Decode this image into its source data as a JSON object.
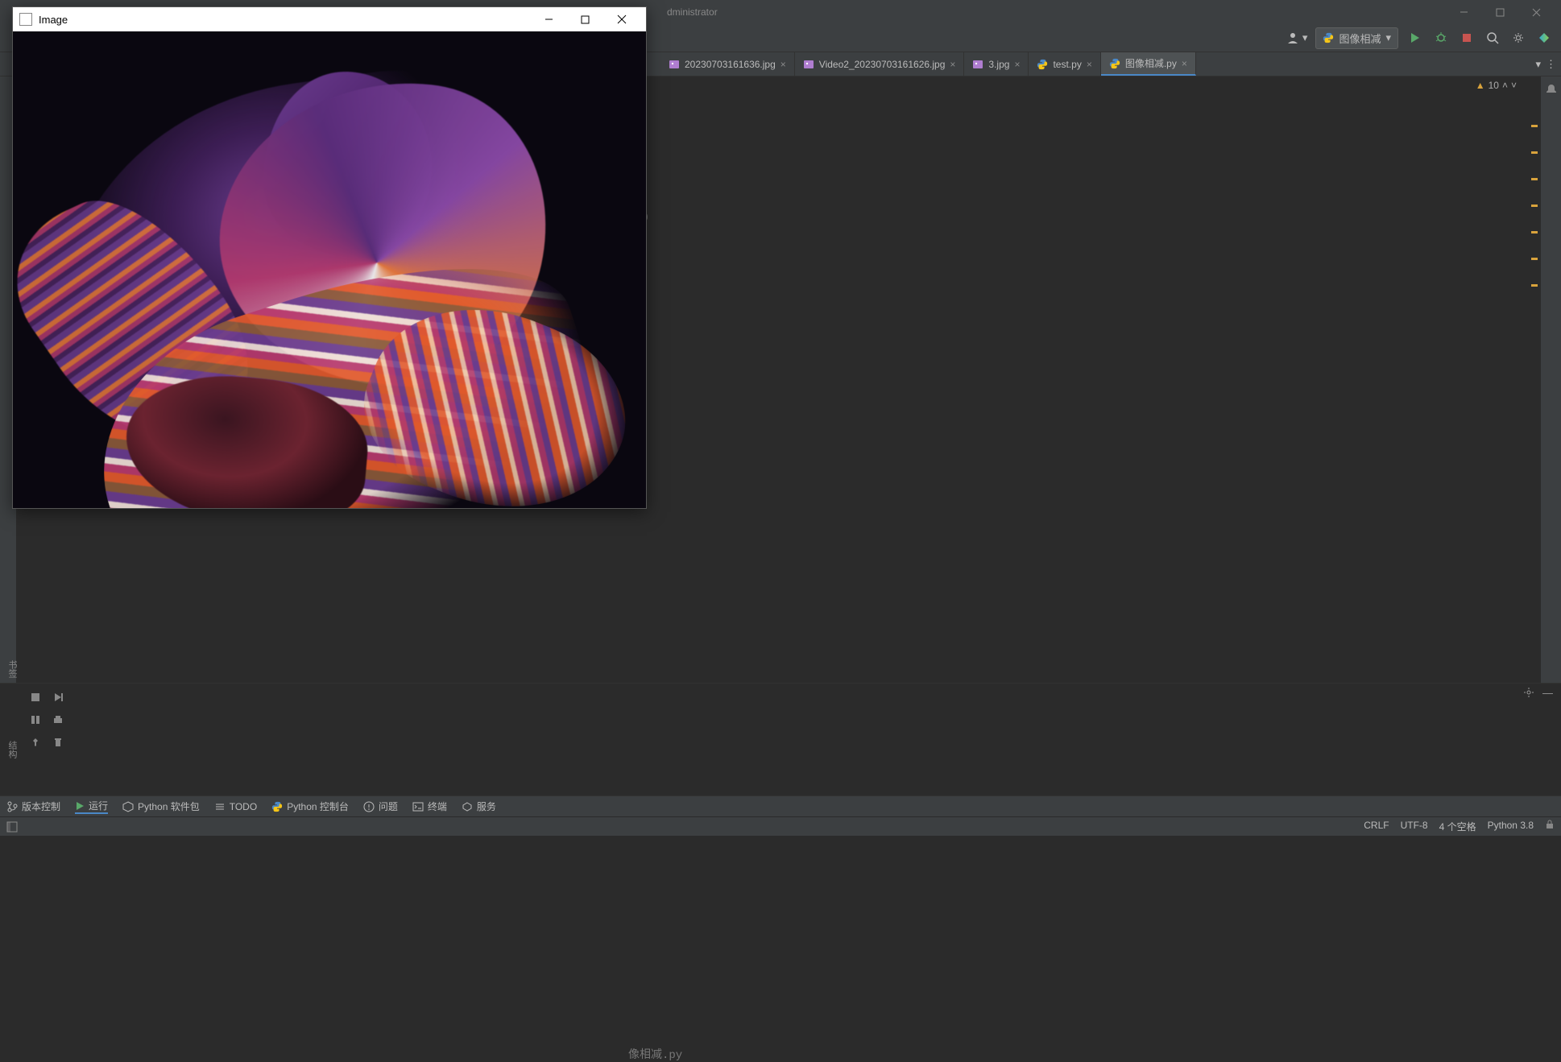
{
  "titlebar": {
    "title_fragment": "dministrator"
  },
  "toolbar": {
    "run_config_label": "图像相减"
  },
  "tabs": [
    {
      "label": "20230703161636.jpg",
      "type": "image",
      "active": false
    },
    {
      "label": "Video2_20230703161626.jpg",
      "type": "image",
      "active": false
    },
    {
      "label": "3.jpg",
      "type": "image",
      "active": false
    },
    {
      "label": "test.py",
      "type": "python",
      "active": false
    },
    {
      "label": "图像相减.py",
      "type": "python",
      "active": true
    }
  ],
  "editor": {
    "warning_count": "10",
    "code_fragment": ")",
    "run_path_fragment": "像相减.py"
  },
  "bottom_tools": {
    "version_control": "版本控制",
    "run": "运行",
    "python_packages": "Python 软件包",
    "todo": "TODO",
    "python_console": "Python 控制台",
    "problems": "问题",
    "terminal": "终端",
    "services": "服务"
  },
  "side_tabs": {
    "bookmarks": "书签",
    "structure": "结构"
  },
  "statusbar": {
    "line_ending": "CRLF",
    "encoding": "UTF-8",
    "indent": "4 个空格",
    "interpreter": "Python 3.8"
  },
  "popup": {
    "title": "Image"
  }
}
